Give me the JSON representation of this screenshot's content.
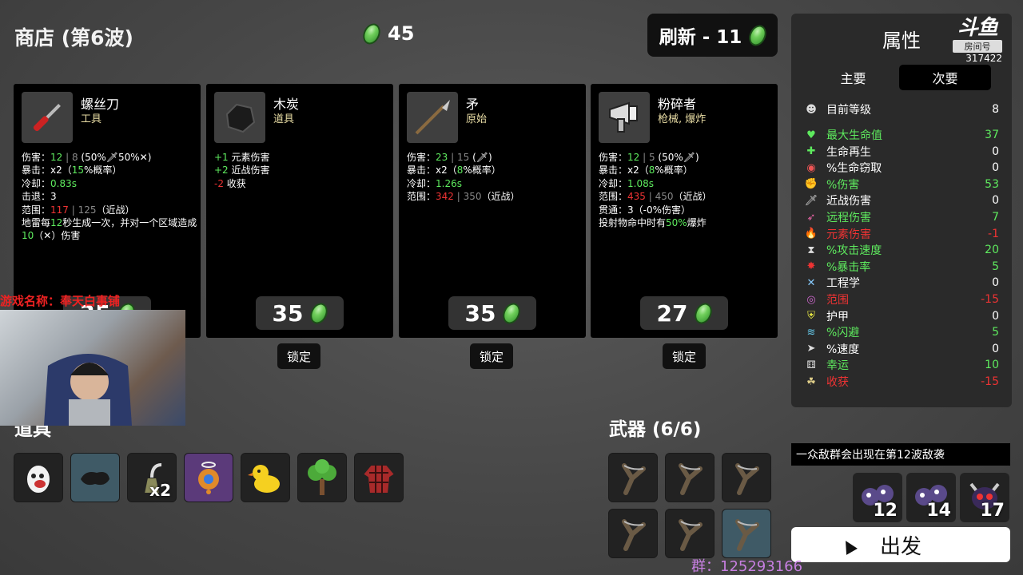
{
  "header": {
    "title": "商店 (第6波)",
    "gold": "45",
    "refresh_label": "刷新 - 11"
  },
  "cards": [
    {
      "name": "螺丝刀",
      "category": "工具",
      "price": "35",
      "stats_html": "伤害：<span class='g'>12</span><span class='gr'> | 8</span> (50%🗡50%✕)<br>暴击：x2（<span class='g'>15</span>%概率）<br>冷却：<span class='g'>0.83s</span><br>击退：3<br>范围：<span class='r'>117</span><span class='gr'> | 125</span>（近战）<br>地雷每<span class='g'>12</span>秒生成一次，并对一个区域造成<span class='g'>10</span>（✕）伤害"
    },
    {
      "name": "木炭",
      "category": "道具",
      "price": "35",
      "stats_html": "<span class='g'>+1</span> 元素伤害<br><span class='g'>+2</span> 近战伤害<br><span class='r'>-2</span> 收获"
    },
    {
      "name": "矛",
      "category": "原始",
      "price": "35",
      "stats_html": "伤害：<span class='g'>23</span><span class='gr'> | 15</span> (🗡)<br>暴击：x2（<span class='g'>8</span>%概率）<br>冷却：<span class='g'>1.26s</span><br>范围：<span class='r'>342</span><span class='gr'> | 350</span>（近战）"
    },
    {
      "name": "粉碎者",
      "category": "枪械, 爆炸",
      "price": "27",
      "stats_html": "伤害：<span class='g'>12</span><span class='gr'> | 5</span> (50%🗡)<br>暴击：x2（<span class='g'>8</span>%概率）<br>冷却：<span class='g'>1.08s</span><br>范围：<span class='r'>435</span><span class='gr'> | 450</span>（近战）<br>贯通：3（-0%伤害）<br>投射物命中时有<span class='g'>50%</span>爆炸"
    }
  ],
  "lock_label": "锁定",
  "attributes": {
    "title": "属性",
    "tabs": [
      "主要",
      "次要"
    ],
    "rows": [
      {
        "icon": "☻",
        "icon_color": "#ddd",
        "label": "目前等级",
        "value": "8",
        "color": "#ffffff"
      },
      {
        "icon": "♥",
        "icon_color": "#5eea5e",
        "label": "最大生命值",
        "value": "37",
        "color": "#5eea5e"
      },
      {
        "icon": "✚",
        "icon_color": "#5eea5e",
        "label": "生命再生",
        "value": "0",
        "color": "#ffffff"
      },
      {
        "icon": "◉",
        "icon_color": "#e55",
        "label": "%生命窃取",
        "value": "0",
        "color": "#ffffff"
      },
      {
        "icon": "✊",
        "icon_color": "#e66",
        "label": "%伤害",
        "value": "53",
        "color": "#5eea5e"
      },
      {
        "icon": "🗡",
        "icon_color": "#ddd",
        "label": "近战伤害",
        "value": "0",
        "color": "#ffffff"
      },
      {
        "icon": "➶",
        "icon_color": "#e6a",
        "label": "远程伤害",
        "value": "7",
        "color": "#5eea5e"
      },
      {
        "icon": "🔥",
        "icon_color": "#e84",
        "label": "元素伤害",
        "value": "-1",
        "color": "#e33"
      },
      {
        "icon": "⧗",
        "icon_color": "#ddd",
        "label": "%攻击速度",
        "value": "20",
        "color": "#5eea5e"
      },
      {
        "icon": "✸",
        "icon_color": "#e33",
        "label": "%暴击率",
        "value": "5",
        "color": "#5eea5e"
      },
      {
        "icon": "✕",
        "icon_color": "#8cf",
        "label": "工程学",
        "value": "0",
        "color": "#ffffff"
      },
      {
        "icon": "◎",
        "icon_color": "#c6c",
        "label": "范围",
        "value": "-15",
        "color": "#e33"
      },
      {
        "icon": "⛨",
        "icon_color": "#ee4",
        "label": "护甲",
        "value": "0",
        "color": "#ffffff"
      },
      {
        "icon": "≋",
        "icon_color": "#6ce",
        "label": "%闪避",
        "value": "5",
        "color": "#5eea5e"
      },
      {
        "icon": "➤",
        "icon_color": "#ddd",
        "label": "%速度",
        "value": "0",
        "color": "#ffffff"
      },
      {
        "icon": "⚅",
        "icon_color": "#ddd",
        "label": "幸运",
        "value": "10",
        "color": "#5eea5e"
      },
      {
        "icon": "☘",
        "icon_color": "#dc8",
        "label": "收获",
        "value": "-15",
        "color": "#e33"
      }
    ]
  },
  "items_section": {
    "title": "道具",
    "items": [
      {
        "icon": "egg-icon",
        "bg": "#222",
        "badge": ""
      },
      {
        "icon": "charcoal-icon",
        "bg": "#3f5a66",
        "badge": ""
      },
      {
        "icon": "gas-sprayer-icon",
        "bg": "#222",
        "badge": "x2"
      },
      {
        "icon": "alien-orb-icon",
        "bg": "#5b3a7a",
        "badge": ""
      },
      {
        "icon": "duck-icon",
        "bg": "#222",
        "badge": ""
      },
      {
        "icon": "tree-icon",
        "bg": "#222",
        "badge": ""
      },
      {
        "icon": "lumberjack-shirt-icon",
        "bg": "#222",
        "badge": ""
      }
    ]
  },
  "weapons_section": {
    "title": "武器 (6/6)"
  },
  "next_wave_msg": "一众敌群会出现在第12波敌袭",
  "enemies": [
    {
      "count": "12"
    },
    {
      "count": "14"
    },
    {
      "count": "17"
    }
  ],
  "go_label": "出发",
  "overlay": {
    "game_name": "游戏名称：奉天白事铺",
    "group": "群：125293166",
    "room_label": "房间号",
    "room_id": "317422",
    "brand": "斗鱼"
  }
}
